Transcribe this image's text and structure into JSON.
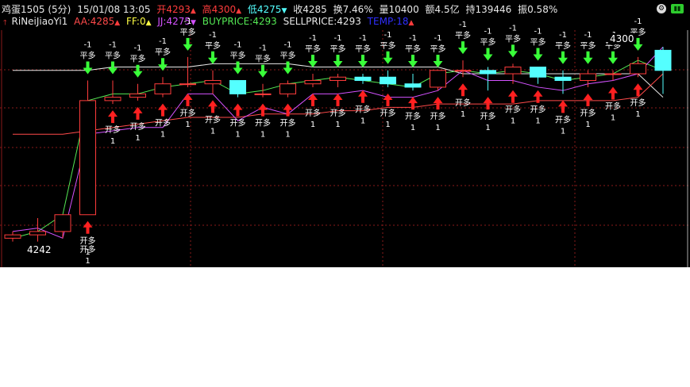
{
  "header": {
    "symbol": "鸡蛋1505 (5分)",
    "datetime": "15/01/08 13:05",
    "open": "开4293",
    "high": "高4300",
    "low": "低4275",
    "close": "收4285",
    "turnover": "换7.46%",
    "volume": "量10400",
    "amount": "额4.5亿",
    "position": "持139446",
    "amplitude": "振0.58%"
  },
  "indicator": {
    "name": "RiNeiJiaoYi1",
    "aa": "AA:4285",
    "ff": "FF:0",
    "jj": "JJ:4275",
    "buyprice": "BUYPRICE:4293",
    "sellprice": "SELLPRICE:4293",
    "temp": "TEMP:18"
  },
  "colors": {
    "up": "#ff3c3c",
    "down": "#54ffff",
    "jj": "#d452ff",
    "buy": "#54e854",
    "aa": "#ff4a4a",
    "temp": "#2f2fff",
    "grid": "#8a1a1a"
  },
  "labels": {
    "high_value": "4300",
    "low_value": "4242",
    "sell_top": "-1",
    "sell_bottom": "平多",
    "buy_top": "开多",
    "buy_bottom": "1"
  },
  "icons": [
    "settings-icon",
    "green-status-icon"
  ],
  "chart_data": {
    "type": "candlestick",
    "bars": [
      {
        "o": 4243,
        "h": 4245,
        "l": 4242,
        "c": 4244
      },
      {
        "o": 4244,
        "h": 4249,
        "l": 4242,
        "c": 4245
      },
      {
        "o": 4245,
        "h": 4250,
        "l": 4243,
        "c": 4250
      },
      {
        "o": 4250,
        "h": 4290,
        "l": 4250,
        "c": 4284
      },
      {
        "o": 4284,
        "h": 4290,
        "l": 4283,
        "c": 4285
      },
      {
        "o": 4285,
        "h": 4289,
        "l": 4284,
        "c": 4286
      },
      {
        "o": 4286,
        "h": 4291,
        "l": 4285,
        "c": 4289
      },
      {
        "o": 4289,
        "h": 4297,
        "l": 4288,
        "c": 4289
      },
      {
        "o": 4289,
        "h": 4293,
        "l": 4286,
        "c": 4290
      },
      {
        "o": 4290,
        "h": 4290,
        "l": 4285,
        "c": 4286
      },
      {
        "o": 4286,
        "h": 4289,
        "l": 4285,
        "c": 4286
      },
      {
        "o": 4286,
        "h": 4290,
        "l": 4285,
        "c": 4289
      },
      {
        "o": 4289,
        "h": 4292,
        "l": 4288,
        "c": 4290
      },
      {
        "o": 4290,
        "h": 4292,
        "l": 4288,
        "c": 4291
      },
      {
        "o": 4291,
        "h": 4292,
        "l": 4289,
        "c": 4290
      },
      {
        "o": 4291,
        "h": 4293,
        "l": 4288,
        "c": 4289
      },
      {
        "o": 4289,
        "h": 4292,
        "l": 4287,
        "c": 4288
      },
      {
        "o": 4288,
        "h": 4292,
        "l": 4287,
        "c": 4293
      },
      {
        "o": 4293,
        "h": 4296,
        "l": 4291,
        "c": 4293
      },
      {
        "o": 4293,
        "h": 4294,
        "l": 4287,
        "c": 4292
      },
      {
        "o": 4292,
        "h": 4295,
        "l": 4289,
        "c": 4294
      },
      {
        "o": 4294,
        "h": 4294,
        "l": 4289,
        "c": 4291
      },
      {
        "o": 4291,
        "h": 4293,
        "l": 4286,
        "c": 4290
      },
      {
        "o": 4290,
        "h": 4293,
        "l": 4288,
        "c": 4292
      },
      {
        "o": 4292,
        "h": 4293,
        "l": 4290,
        "c": 4292
      },
      {
        "o": 4292,
        "h": 4297,
        "l": 4291,
        "c": 4295
      },
      {
        "o": 4299,
        "h": 4300,
        "l": 4286,
        "c": 4293
      }
    ],
    "aa_line": [
      4293,
      4293,
      4293,
      4293,
      4294,
      4294,
      4294,
      4294,
      4295,
      4295,
      4295,
      4295,
      4294,
      4294,
      4294,
      4294,
      4294,
      4294,
      4292,
      4292,
      4292,
      4292,
      4292,
      4292,
      4292,
      4292,
      4285
    ],
    "ff_line": [
      4274,
      4274,
      4274,
      4275,
      4276,
      4277,
      4278,
      4279,
      4279,
      4279,
      4280,
      4280,
      4280,
      4281,
      4281,
      4282,
      4282,
      4283,
      4283,
      4283,
      4283,
      4284,
      4284,
      4284,
      4284,
      4285,
      4292
    ],
    "jj_line": [
      4245,
      4246,
      4243,
      4274,
      4275,
      4276,
      4276,
      4286,
      4286,
      4278,
      4282,
      4280,
      4286,
      4286,
      4287,
      4285,
      4285,
      4287,
      4293,
      4290,
      4290,
      4288,
      4287,
      4289,
      4290,
      4292,
      4300
    ],
    "buy_line": [
      4243,
      4245,
      4250,
      4284,
      4286,
      4286,
      4288,
      4289,
      4290,
      4286,
      4287,
      4289,
      4290,
      4291,
      4290,
      4289,
      4288,
      4292,
      4293,
      4292,
      4293,
      4292,
      4290,
      4291,
      4292,
      4296,
      4293
    ],
    "signal_bars": [
      3,
      4,
      5,
      6,
      7,
      8,
      9,
      10,
      11,
      12,
      13,
      14,
      15,
      16,
      17,
      18,
      19,
      20,
      21,
      22,
      23,
      24,
      25
    ],
    "ylim": [
      4236,
      4305
    ]
  }
}
